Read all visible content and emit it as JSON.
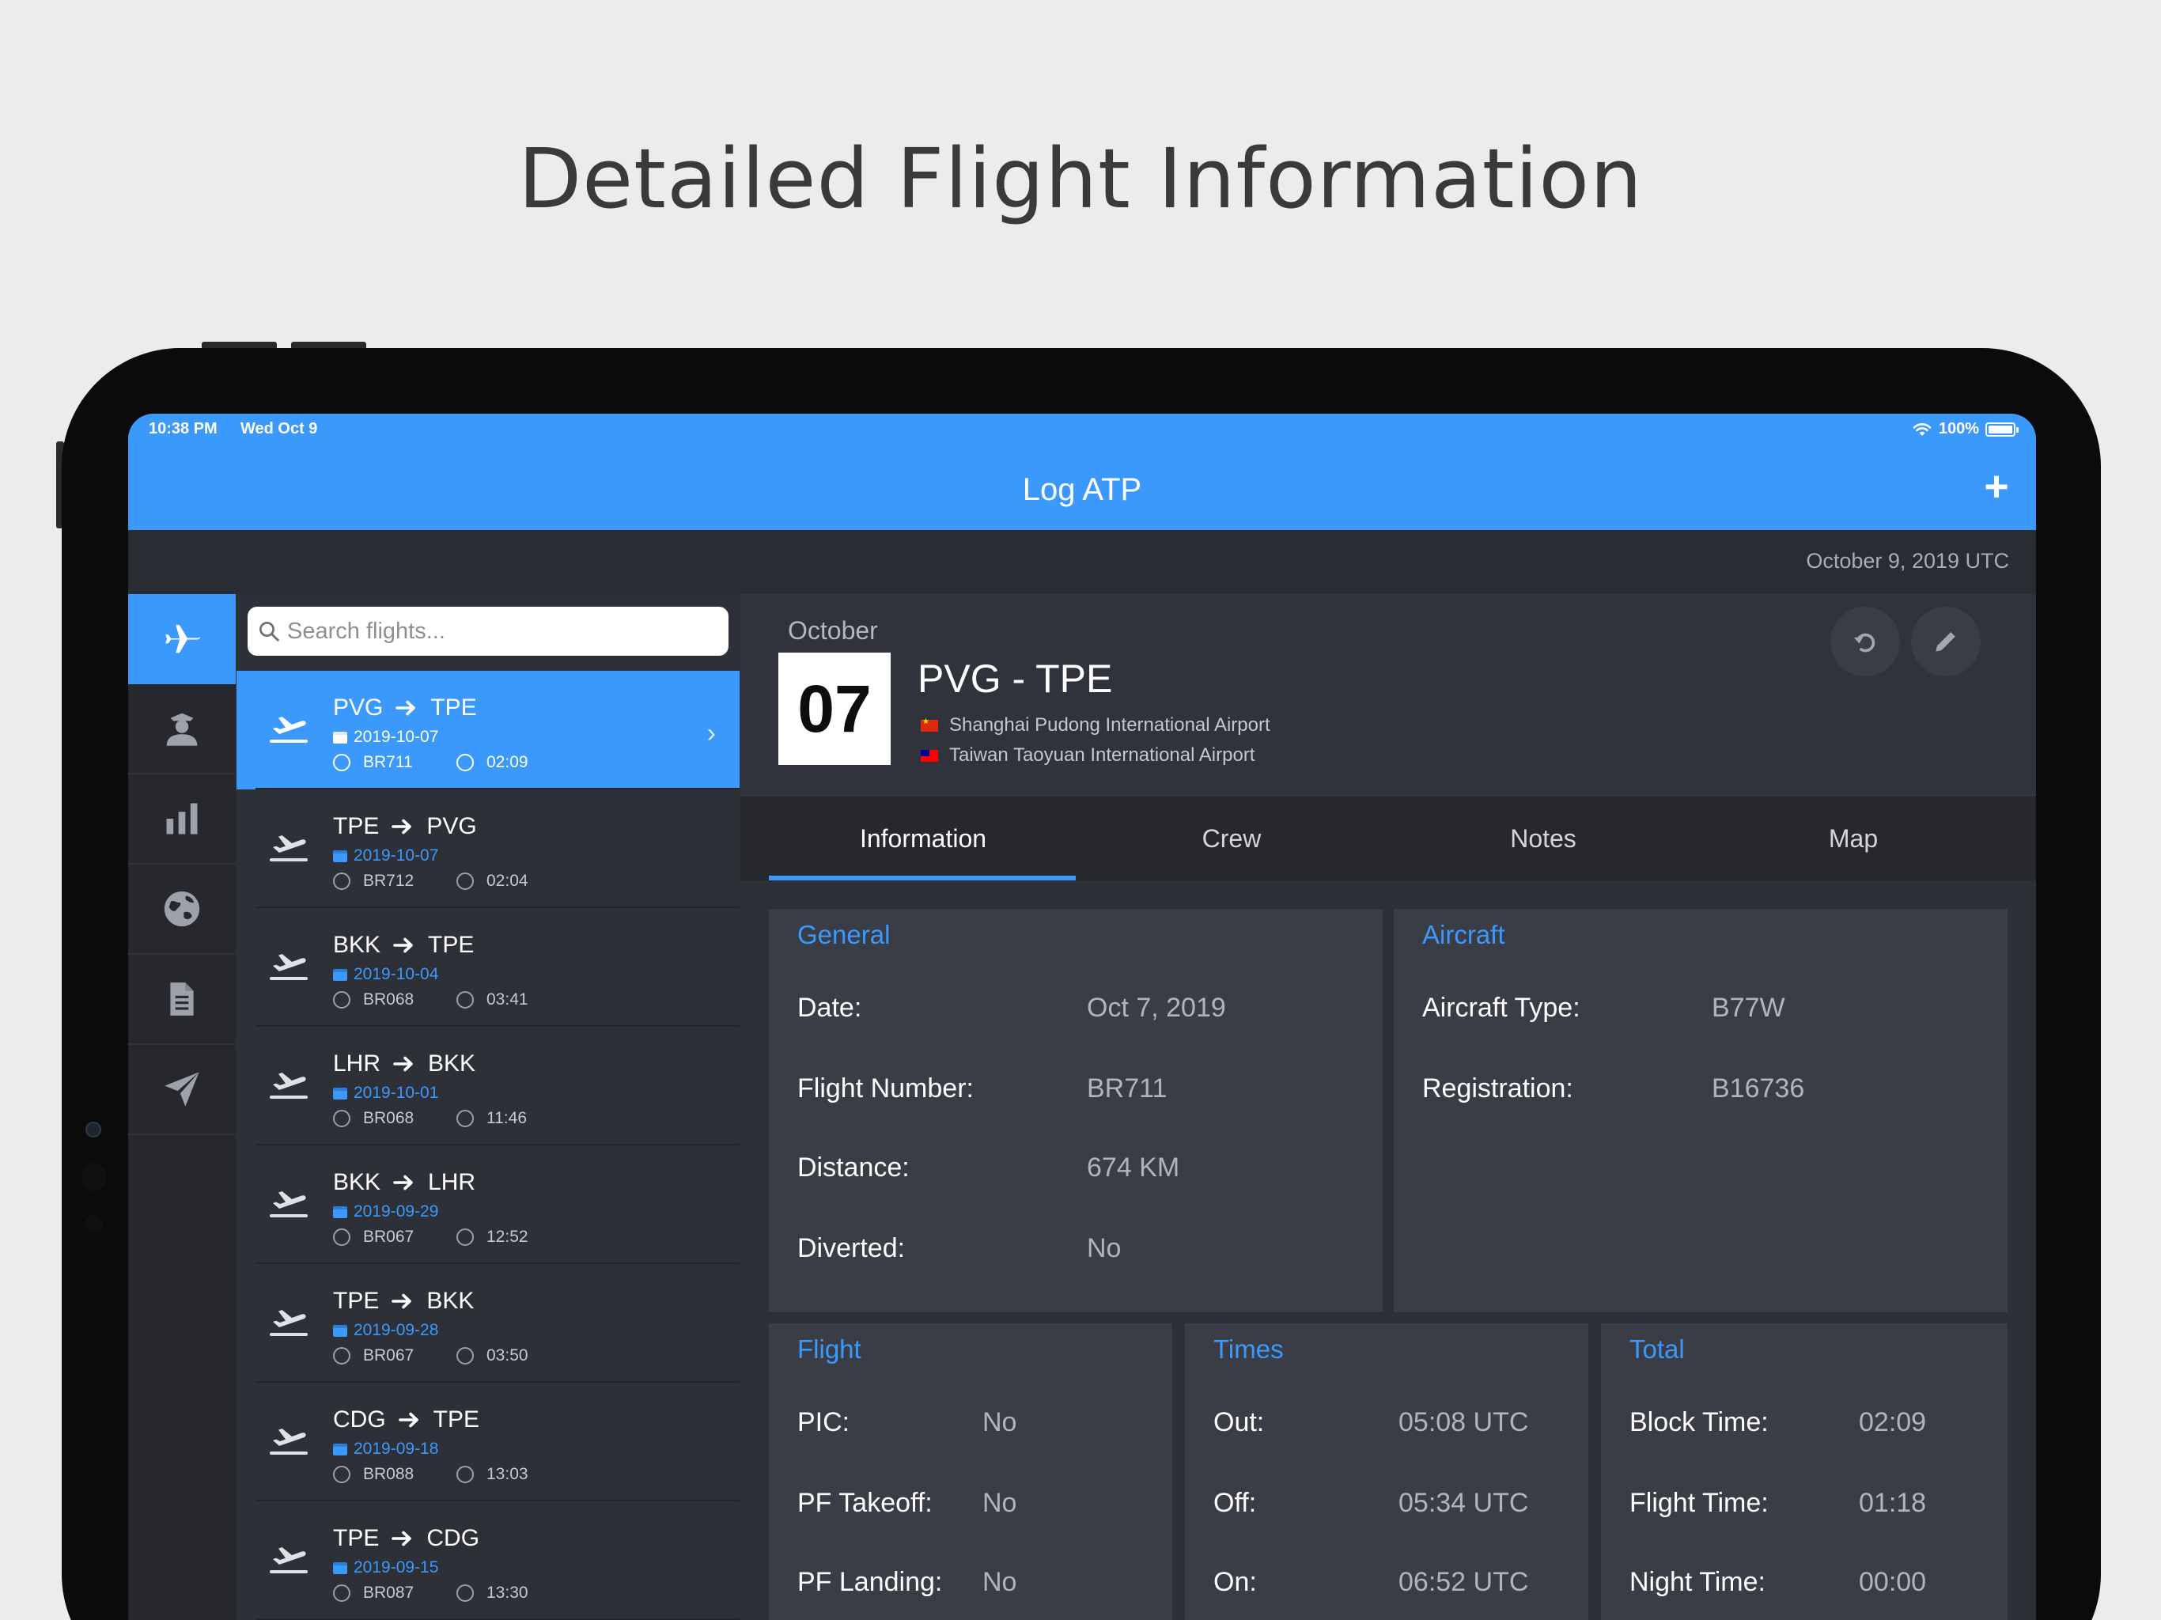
{
  "headline": "Detailed Flight Information",
  "status": {
    "time": "10:38 PM",
    "date": "Wed Oct 9",
    "battery": "100%"
  },
  "nav": {
    "title": "Log ATP",
    "add_label": "+"
  },
  "date_banner": "October 9, 2019 UTC",
  "search": {
    "placeholder": "Search flights..."
  },
  "rail": [
    "flights-icon",
    "crew-icon",
    "stats-icon",
    "globe-icon",
    "document-icon",
    "paper-plane-icon"
  ],
  "flights": [
    {
      "from": "PVG",
      "to": "TPE",
      "date": "2019-10-07",
      "flight": "BR711",
      "time": "02:09",
      "selected": true
    },
    {
      "from": "TPE",
      "to": "PVG",
      "date": "2019-10-07",
      "flight": "BR712",
      "time": "02:04"
    },
    {
      "from": "BKK",
      "to": "TPE",
      "date": "2019-10-04",
      "flight": "BR068",
      "time": "03:41"
    },
    {
      "from": "LHR",
      "to": "BKK",
      "date": "2019-10-01",
      "flight": "BR068",
      "time": "11:46"
    },
    {
      "from": "BKK",
      "to": "LHR",
      "date": "2019-09-29",
      "flight": "BR067",
      "time": "12:52"
    },
    {
      "from": "TPE",
      "to": "BKK",
      "date": "2019-09-28",
      "flight": "BR067",
      "time": "03:50"
    },
    {
      "from": "CDG",
      "to": "TPE",
      "date": "2019-09-18",
      "flight": "BR088",
      "time": "13:03"
    },
    {
      "from": "TPE",
      "to": "CDG",
      "date": "2019-09-15",
      "flight": "BR087",
      "time": "13:30"
    }
  ],
  "detail": {
    "month": "October",
    "day": "07",
    "route": "PVG - TPE",
    "origin": "Shanghai Pudong International Airport",
    "destination": "Taiwan Taoyuan International Airport",
    "tabs": [
      "Information",
      "Crew",
      "Notes",
      "Map"
    ],
    "general": {
      "title": "General",
      "rows": [
        {
          "label": "Date:",
          "value": "Oct 7, 2019"
        },
        {
          "label": "Flight Number:",
          "value": "BR711"
        },
        {
          "label": "Distance:",
          "value": "674 KM"
        },
        {
          "label": "Diverted:",
          "value": "No"
        }
      ]
    },
    "aircraft": {
      "title": "Aircraft",
      "rows": [
        {
          "label": "Aircraft Type:",
          "value": "B77W"
        },
        {
          "label": "Registration:",
          "value": "B16736"
        }
      ]
    },
    "flight": {
      "title": "Flight",
      "rows": [
        {
          "label": "PIC:",
          "value": "No"
        },
        {
          "label": "PF Takeoff:",
          "value": "No"
        },
        {
          "label": "PF Landing:",
          "value": "No"
        }
      ]
    },
    "times": {
      "title": "Times",
      "rows": [
        {
          "label": "Out:",
          "value": "05:08 UTC"
        },
        {
          "label": "Off:",
          "value": "05:34 UTC"
        },
        {
          "label": "On:",
          "value": "06:52 UTC"
        }
      ]
    },
    "total": {
      "title": "Total",
      "rows": [
        {
          "label": "Block Time:",
          "value": "02:09"
        },
        {
          "label": "Flight Time:",
          "value": "01:18"
        },
        {
          "label": "Night Time:",
          "value": "00:00"
        }
      ]
    }
  },
  "colors": {
    "accent": "#3b99fc",
    "panel": "#2e3038",
    "card": "#3a3d46"
  }
}
